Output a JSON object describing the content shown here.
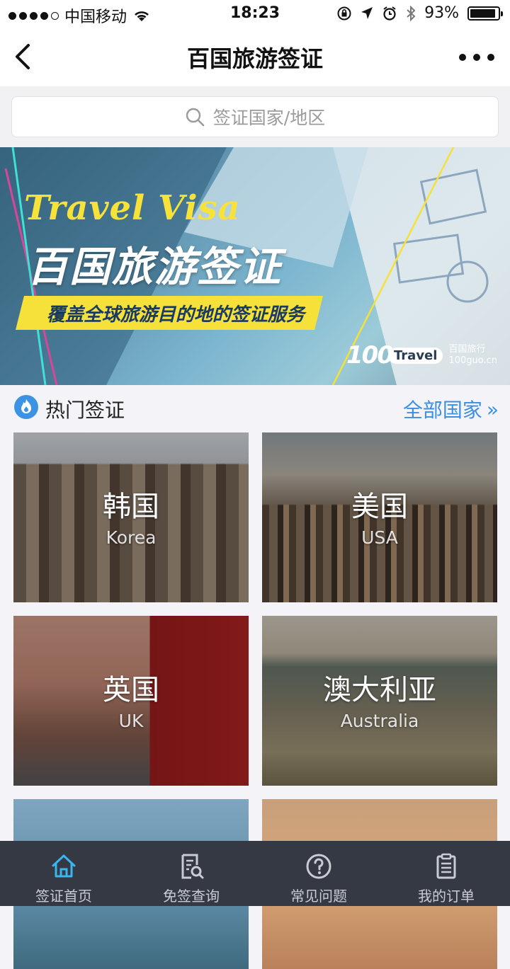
{
  "status_bar": {
    "carrier": "中国移动",
    "time": "18:23",
    "battery": "93%",
    "battery_level": 0.93
  },
  "nav": {
    "title": "百国旅游签证",
    "back_icon": "chevron-left-icon",
    "more_icon": "more-dots-icon"
  },
  "search": {
    "placeholder": "签证国家/地区",
    "icon": "search-icon"
  },
  "banner": {
    "tagline_en": "Travel Visa",
    "title": "百国旅游签证",
    "ribbon": "覆盖全球旅游目的地的签证服务",
    "logo_number": "100",
    "logo_word": "Travel",
    "logo_cn": "百国旅行",
    "logo_url": "100guo.cn"
  },
  "section": {
    "title": "热门签证",
    "more_label": "全部国家",
    "more_glyph": "»",
    "icon": "flame-icon"
  },
  "cards": [
    {
      "cn": "韩国",
      "en": "Korea"
    },
    {
      "cn": "美国",
      "en": "USA"
    },
    {
      "cn": "英国",
      "en": "UK"
    },
    {
      "cn": "澳大利亚",
      "en": "Australia"
    }
  ],
  "tabs": [
    {
      "label": "签证首页",
      "icon": "home-icon",
      "active": true
    },
    {
      "label": "免签查询",
      "icon": "document-search-icon",
      "active": false
    },
    {
      "label": "常见问题",
      "icon": "question-icon",
      "active": false
    },
    {
      "label": "我的订单",
      "icon": "clipboard-icon",
      "active": false
    }
  ],
  "colors": {
    "accent": "#3b8fe0",
    "tab_active": "#38b6ef",
    "tabbar_bg": "#343944",
    "ribbon": "#f6e13b"
  }
}
